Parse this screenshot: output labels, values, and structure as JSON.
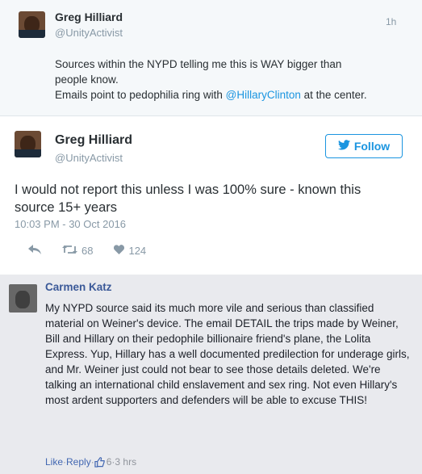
{
  "tweet1": {
    "name": "Greg Hilliard",
    "handle": "@UnityActivist",
    "time": "1h",
    "line1": "Sources within the NYPD telling me this is WAY bigger than",
    "line2": "people know.",
    "line3_pre": "Emails point to pedophilia ring with ",
    "mention": "@HillaryClinton",
    "line3_post": " at the center."
  },
  "tweet2": {
    "name": "Greg Hilliard",
    "handle": "@UnityActivist",
    "follow_label": "Follow",
    "text": "I would not report this unless I was 100% sure - known this source 15+ years",
    "date": "10:03 PM - 30 Oct 2016",
    "retweets": "68",
    "likes": "124"
  },
  "comment": {
    "name": "Carmen Katz",
    "text": "My NYPD source said its much more vile and serious than classified material on Weiner's device. The email DETAIL the trips made by Weiner, Bill and Hillary on their pedophile billionaire friend's plane, the Lolita Express. Yup, Hillary has a well documented predilection for underage girls, and Mr. Weiner just could not bear to see those details deleted. We're talking an international child enslavement and sex ring. Not even Hillary's most ardent supporters and defenders will be able to excuse THIS!",
    "like_label": "Like",
    "sep1": " · ",
    "reply_label": "Reply",
    "sep2": " · ",
    "reactions": "6",
    "sep3": " · ",
    "time": "3 hrs"
  },
  "colors": {
    "link": "#1b95e0",
    "fb_link": "#4267b2",
    "fb_name": "#3b5998",
    "muted": "#8899a6"
  },
  "icons": {
    "follow": "twitter-bird-icon",
    "reply": "reply-icon",
    "retweet": "retweet-icon",
    "like": "heart-icon",
    "reaction": "thumbs-up-icon"
  }
}
